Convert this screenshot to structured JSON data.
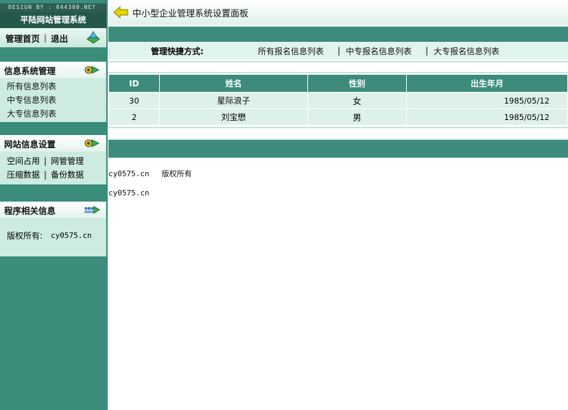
{
  "sidebar": {
    "design_credit": "DESIGN BY : 044300.NET",
    "system_title": "平陆网站管理系统",
    "home_label": "管理首页",
    "logout_label": "退出",
    "panels": [
      {
        "title": "信息系统管理",
        "items": [
          "所有信息列表",
          "中专信息列表",
          "大专信息列表"
        ]
      },
      {
        "title": "网站信息设置",
        "rows": [
          [
            "空间占用",
            "网管管理"
          ],
          [
            "压缩数据",
            "备份数据"
          ]
        ]
      },
      {
        "title": "程序相关信息",
        "copyright_label": "版权所有:",
        "copyright_value": "cy0575.cn"
      }
    ]
  },
  "main": {
    "page_title": "中小型企业管理系统设置面板",
    "shortcut": {
      "label": "管理快捷方式:",
      "links": [
        "所有报名信息列表",
        "中专报名信息列表",
        "大专报名信息列表"
      ]
    },
    "table": {
      "headers": [
        "ID",
        "姓名",
        "性别",
        "出生年月"
      ],
      "rows": [
        [
          "30",
          "星际浪子",
          "女",
          "1985/05/12"
        ],
        [
          "2",
          "刘宝懋",
          "男",
          "1985/05/12"
        ]
      ]
    },
    "footer": {
      "line1_domain": "cy0575.cn",
      "line1_rights": "版权所有",
      "line2_domain": "cy0575.cn"
    }
  },
  "colors": {
    "sidebar_bg": "#3a8c7b",
    "header_dark": "#24584b",
    "band_green": "#3d8c7b",
    "light_row": "#ddf1ea",
    "icon_yellow": "#e8c400",
    "icon_green": "#3faa55"
  },
  "icons": {
    "home": "home-recycle-icon",
    "panel1": "gear-arrow-icon",
    "panel2": "gear-arrow-icon",
    "panel3": "users-arrow-icon",
    "title": "back-arrow-icon"
  }
}
